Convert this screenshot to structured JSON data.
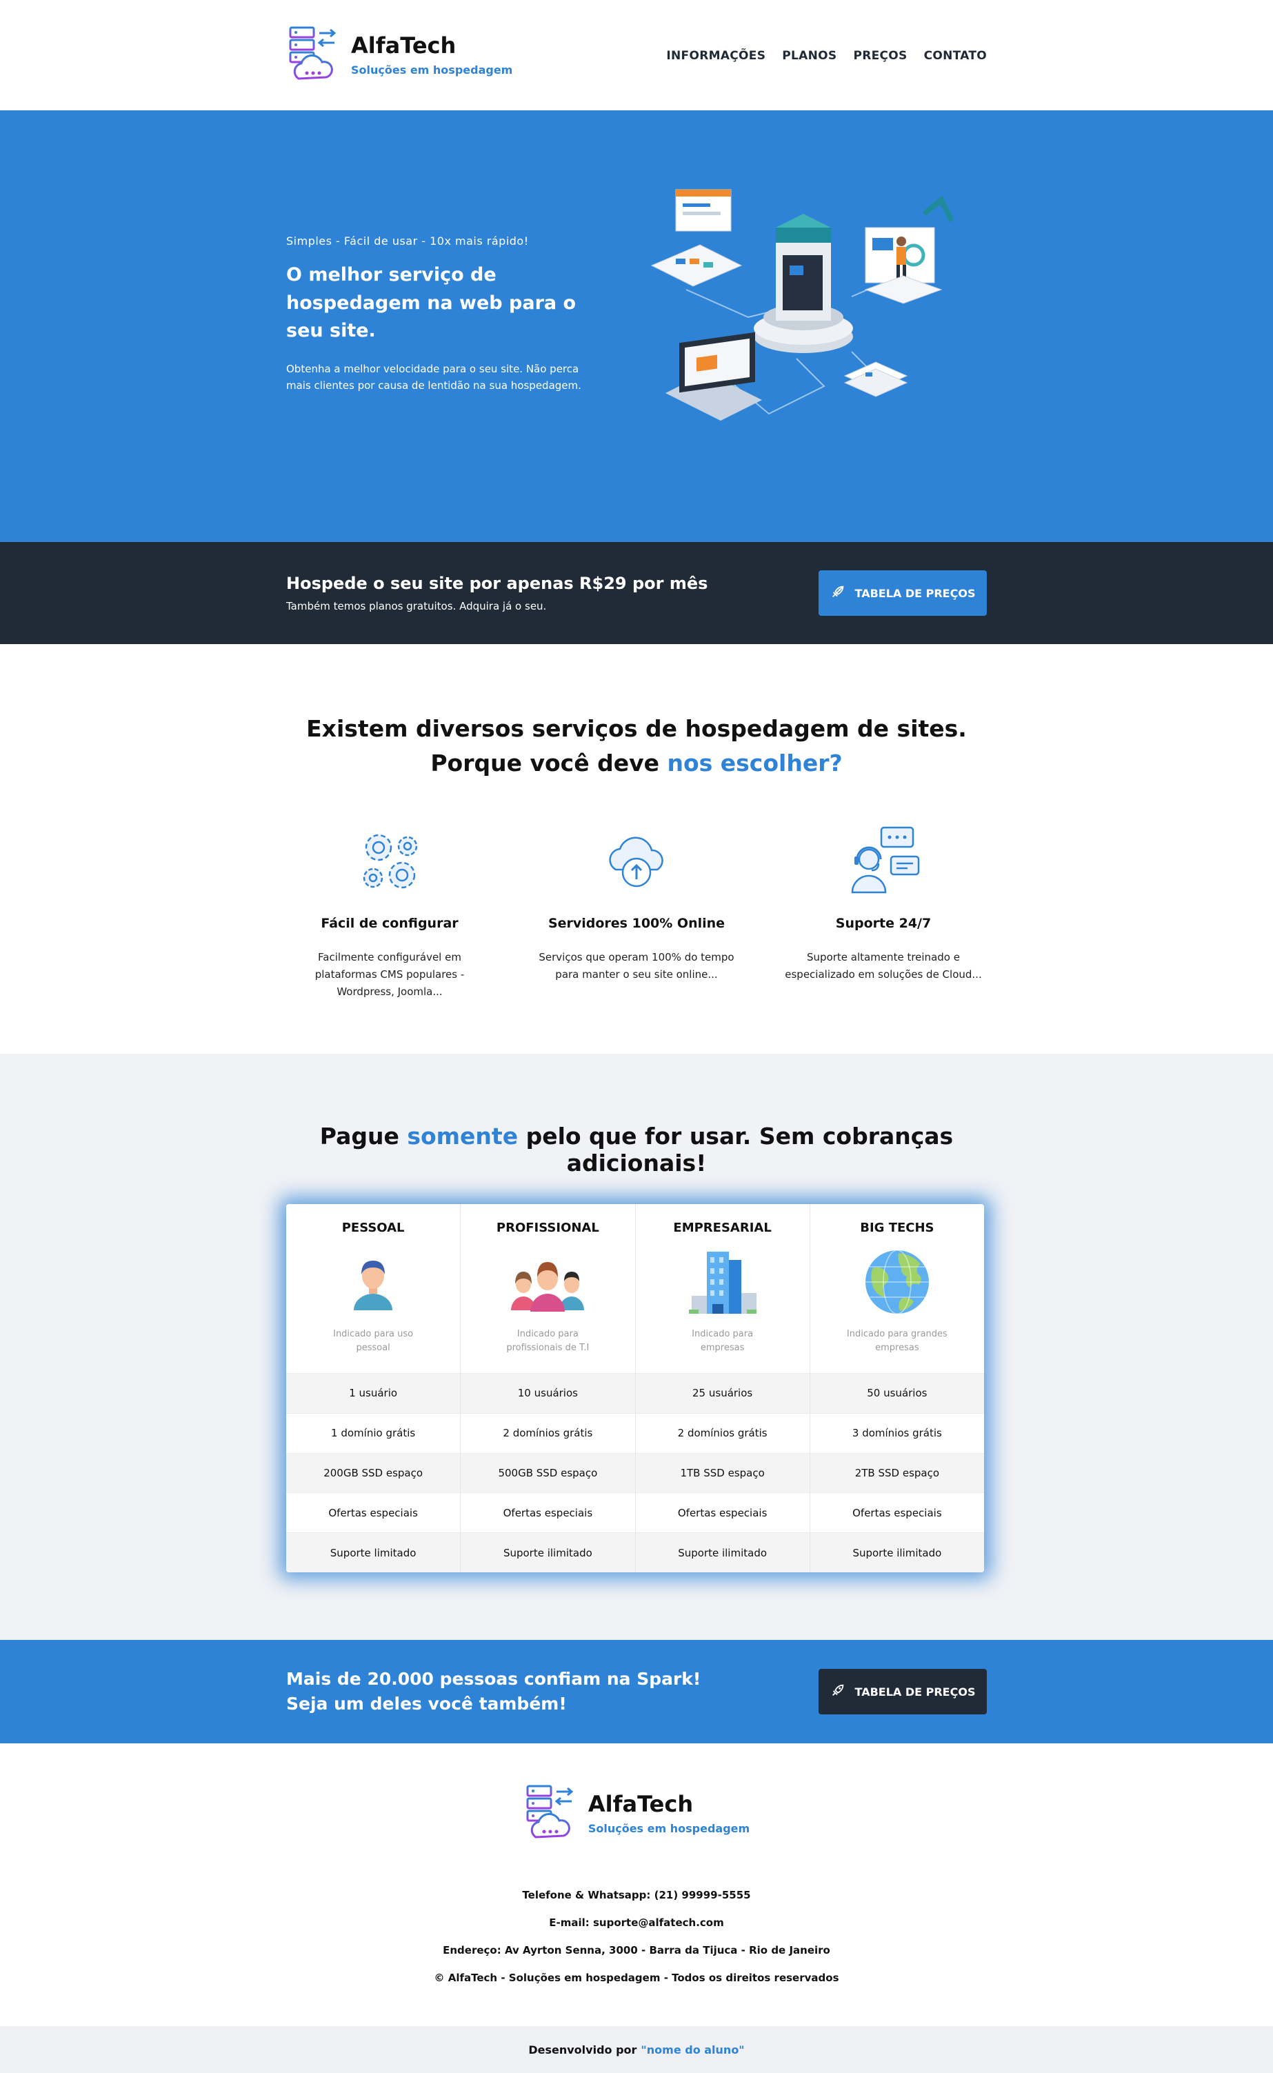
{
  "brand": {
    "name": "AlfaTech",
    "tagline": "Soluções em hospedagem",
    "logo_icon": "server-cloud-logo-icon"
  },
  "nav": {
    "items": [
      "INFORMAÇÕES",
      "PLANOS",
      "PREÇOS",
      "CONTATO"
    ]
  },
  "hero": {
    "eyebrow": "Simples - Fácil de usar - 10x mais rápido!",
    "title": "O melhor serviço de hospedagem na web para o seu site.",
    "description": "Obtenha a melhor velocidade para o seu site. Não perca mais clientes por causa de lentidão na sua hospedagem."
  },
  "promo": {
    "title": "Hospede o seu site por apenas R$29 por mês",
    "subtitle": "Também temos planos gratuitos. Adquira já o seu.",
    "button": "TABELA DE PREÇOS",
    "button_icon": "rocket-icon"
  },
  "features": {
    "heading_line1": "Existem diversos serviços de hospedagem de sites.",
    "heading_line2_prefix": "Porque você deve ",
    "heading_line2_highlight": "nos escolher?",
    "items": [
      {
        "icon": "gears-icon",
        "title": "Fácil de configurar",
        "desc": "Facilmente configurável em plataformas CMS populares - Wordpress, Joomla..."
      },
      {
        "icon": "cloud-upload-icon",
        "title": "Servidores 100% Online",
        "desc": "Serviços que operam 100% do tempo para manter o seu site online..."
      },
      {
        "icon": "support-agent-icon",
        "title": "Suporte 24/7",
        "desc": "Suporte altamente treinado e especializado em soluções de Cloud..."
      }
    ]
  },
  "pricing": {
    "heading_prefix": "Pague ",
    "heading_highlight": "somente",
    "heading_suffix": " pelo que for usar. Sem cobranças adicionais!",
    "plans": [
      {
        "name": "PESSOAL",
        "icon": "person-icon",
        "indicated": "Indicado para uso pessoal",
        "users": "1 usuário",
        "domains": "1 domínio grátis",
        "space": "200GB SSD espaço",
        "offers": "Ofertas especiais",
        "support": "Suporte limitado"
      },
      {
        "name": "PROFISSIONAL",
        "icon": "team-icon",
        "indicated": "Indicado para profissionais de T.I",
        "users": "10 usuários",
        "domains": "2 domínios grátis",
        "space": "500GB SSD espaço",
        "offers": "Ofertas especiais",
        "support": "Suporte ilimitado"
      },
      {
        "name": "EMPRESARIAL",
        "icon": "building-icon",
        "indicated": "Indicado para empresas",
        "users": "25 usuários",
        "domains": "2 domínios grátis",
        "space": "1TB SSD espaço",
        "offers": "Ofertas especiais",
        "support": "Suporte ilimitado"
      },
      {
        "name": "BIG TECHS",
        "icon": "globe-icon",
        "indicated": "Indicado para grandes empresas",
        "users": "50 usuários",
        "domains": "3 domínios grátis",
        "space": "2TB SSD espaço",
        "offers": "Ofertas especiais",
        "support": "Suporte ilimitado"
      }
    ]
  },
  "trust": {
    "line1": "Mais de 20.000 pessoas confiam na Spark!",
    "line2": "Seja um deles você também!",
    "button": "TABELA DE PREÇOS"
  },
  "footer": {
    "phone": "Telefone & Whatsapp: (21) 99999-5555",
    "email": "E-mail: suporte@alfatech.com",
    "address": "Endereço: Av Ayrton Senna, 3000 - Barra da Tijuca - Rio de Janeiro",
    "copyright": "© AlfaTech - Soluções em hospedagem - Todos os direitos reservados"
  },
  "credits": {
    "prefix": "Desenvolvido por",
    "link": "\"nome do aluno\""
  },
  "colors": {
    "primary": "#2f83d6",
    "dark": "#212b38",
    "light_bg": "#f0f2f6"
  }
}
